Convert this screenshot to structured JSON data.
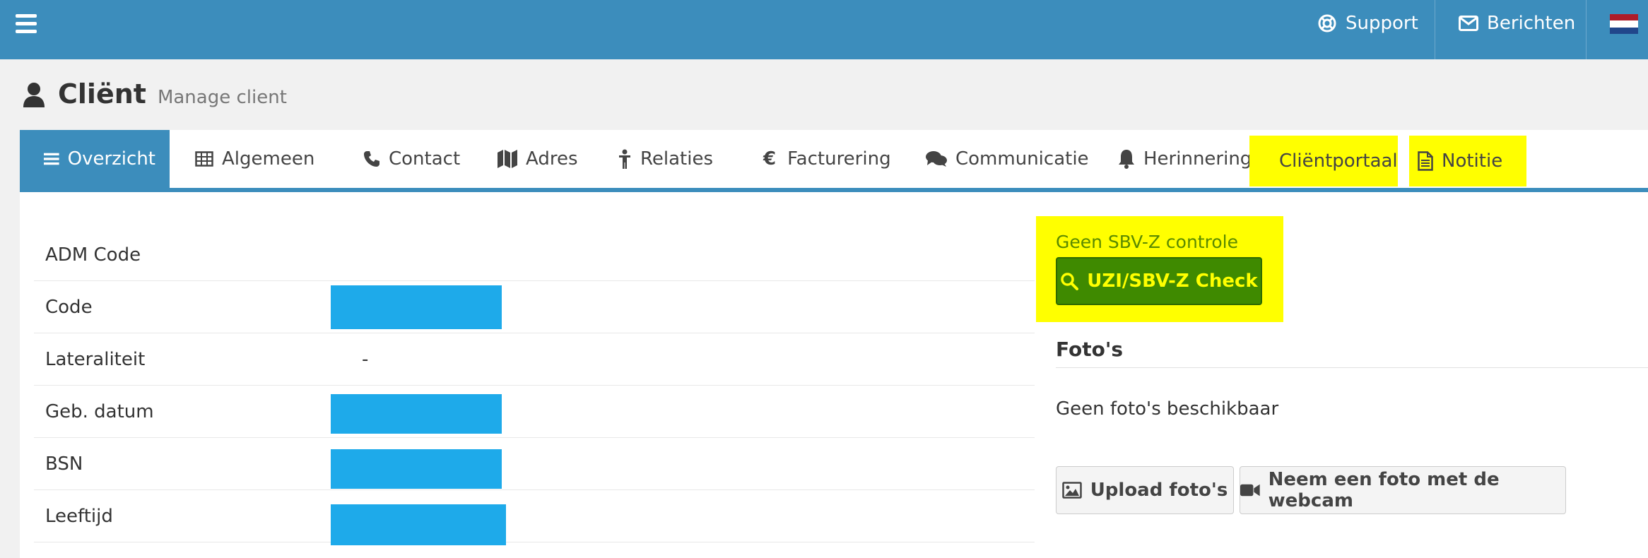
{
  "topbar": {
    "menu_icon": "hamburger-icon",
    "support_label": "Support",
    "support_icon": "lifebuoy-icon",
    "messages_label": "Berichten",
    "messages_icon": "envelope-icon",
    "language_flag": "netherlands-flag-icon",
    "flag_colors": [
      "#ae1c28",
      "#ffffff",
      "#21468b"
    ]
  },
  "header": {
    "title": "Cliënt",
    "subtitle": "Manage client",
    "icon": "user-icon"
  },
  "tabs": [
    {
      "label": "Overzicht",
      "icon": "list-icon",
      "active": true
    },
    {
      "label": "Algemeen",
      "icon": "table-icon"
    },
    {
      "label": "Contact",
      "icon": "phone-icon"
    },
    {
      "label": "Adres",
      "icon": "map-icon"
    },
    {
      "label": "Relaties",
      "icon": "person-icon"
    },
    {
      "label": "Facturering",
      "icon": "euro-icon"
    },
    {
      "label": "Communicatie",
      "icon": "comments-icon"
    },
    {
      "label": "Herinnering",
      "icon": "bell-icon"
    },
    {
      "label": "Cliëntportaal",
      "icon": "globe-icon",
      "highlight": true
    },
    {
      "label": "Notitie",
      "icon": "document-icon",
      "highlight": true
    }
  ],
  "info": [
    {
      "label": "ADM Code",
      "value": ""
    },
    {
      "label": "Code",
      "value": "",
      "redacted": true
    },
    {
      "label": "Lateraliteit",
      "value": "-"
    },
    {
      "label": "Geb. datum",
      "value": "",
      "redacted": true
    },
    {
      "label": "BSN",
      "value": "",
      "redacted": true
    },
    {
      "label": "Leeftijd",
      "value": "",
      "redacted": true
    }
  ],
  "sbv": {
    "status": "Geen SBV-Z controle",
    "button_label": "UZI/SBV-Z Check",
    "button_icon": "search-icon"
  },
  "photos": {
    "title": "Foto's",
    "empty_text": "Geen foto's beschikbaar",
    "upload_label": "Upload foto's",
    "upload_icon": "image-icon",
    "webcam_label": "Neem een foto met de webcam",
    "webcam_icon": "video-camera-icon"
  },
  "colors": {
    "primary": "#3c8dbc",
    "highlight": "#ffff00",
    "redaction": "#1eaaea",
    "success": "#3f8a00"
  }
}
